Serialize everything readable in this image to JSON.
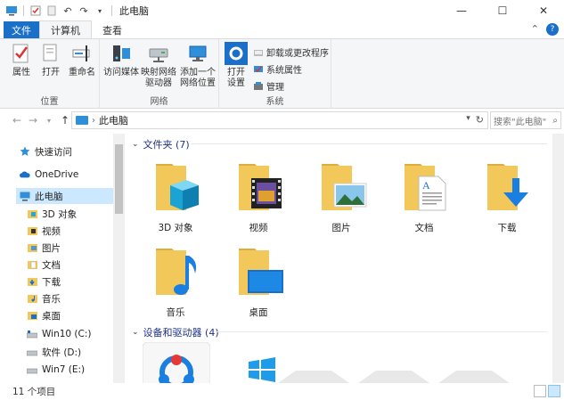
{
  "window": {
    "title": "此电脑",
    "minimize": "—",
    "maximize": "☐",
    "close": "✕"
  },
  "ribbon_tabs": [
    {
      "label": "文件"
    },
    {
      "label": "计算机"
    },
    {
      "label": "查看"
    }
  ],
  "ribbon": {
    "groups": [
      {
        "label": "位置",
        "buttons": [
          "属性",
          "打开",
          "重命名"
        ]
      },
      {
        "label": "网络",
        "buttons": [
          "访问媒体",
          "映射网络\n驱动器",
          "添加一个\n网络位置"
        ]
      },
      {
        "label": "系统",
        "buttons": [
          "打开\n设置"
        ],
        "small": [
          "卸载或更改程序",
          "系统属性",
          "管理"
        ]
      }
    ]
  },
  "address": {
    "path": "此电脑",
    "search_placeholder": "搜索\"此电脑\""
  },
  "nav": {
    "items": [
      {
        "label": "快速访问",
        "icon": "star-icon"
      },
      {
        "label": "OneDrive",
        "icon": "cloud-icon"
      },
      {
        "label": "此电脑",
        "icon": "computer-icon"
      },
      {
        "label": "3D 对象",
        "icon": "3d-objects-icon"
      },
      {
        "label": "视频",
        "icon": "video-icon"
      },
      {
        "label": "图片",
        "icon": "pictures-icon"
      },
      {
        "label": "文档",
        "icon": "documents-icon"
      },
      {
        "label": "下载",
        "icon": "downloads-icon"
      },
      {
        "label": "音乐",
        "icon": "music-icon"
      },
      {
        "label": "桌面",
        "icon": "desktop-icon"
      },
      {
        "label": "Win10 (C:)",
        "icon": "drive-icon"
      },
      {
        "label": "软件 (D:)",
        "icon": "drive-icon"
      },
      {
        "label": "Win7 (E:)",
        "icon": "drive-icon"
      }
    ]
  },
  "content": {
    "folders_header": "文件夹 (7)",
    "folders": [
      {
        "label": "3D 对象",
        "icon": "3d-objects-folder-icon"
      },
      {
        "label": "视频",
        "icon": "video-folder-icon"
      },
      {
        "label": "图片",
        "icon": "pictures-folder-icon"
      },
      {
        "label": "文档",
        "icon": "documents-folder-icon"
      },
      {
        "label": "下载",
        "icon": "downloads-folder-icon"
      },
      {
        "label": "音乐",
        "icon": "music-folder-icon"
      },
      {
        "label": "桌面",
        "icon": "desktop-folder-icon"
      }
    ],
    "devices_header": "设备和驱动器 (4)"
  },
  "status": {
    "item_count": "11 个项目"
  },
  "colors": {
    "accent": "#1a6fc9",
    "folder": "#f3c85b",
    "folder_dark": "#dcae3f",
    "selection": "#cce8ff"
  }
}
